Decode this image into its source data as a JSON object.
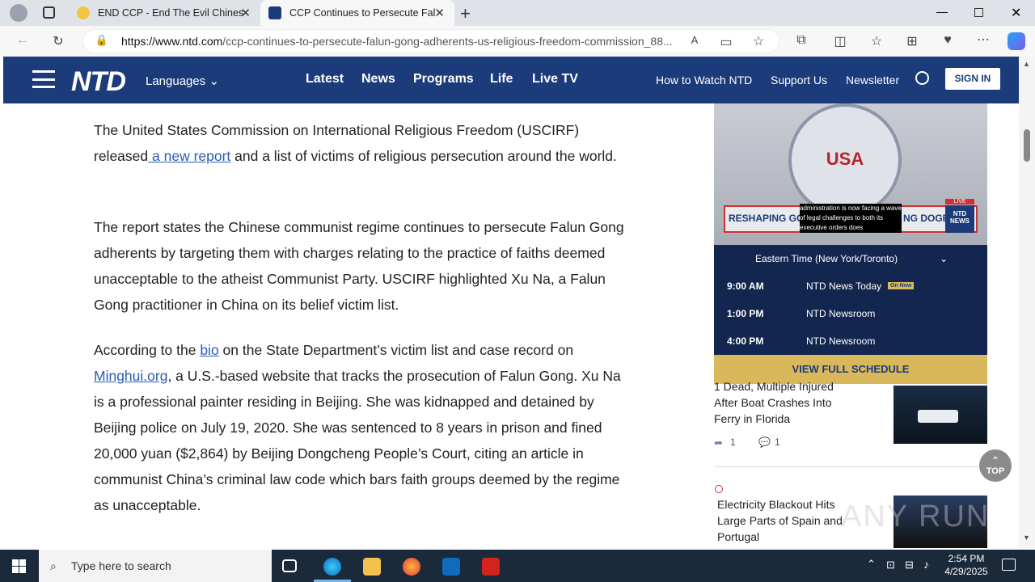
{
  "browser": {
    "tabs": [
      {
        "title": "END CCP - End The Evil Chinese",
        "favicon_color": "#f4c542"
      },
      {
        "title": "CCP Continues to Persecute Falu",
        "favicon_color": "#1c3b7a"
      }
    ],
    "url_host": "https://www.ntd.com",
    "url_path": "/ccp-continues-to-persecute-falun-gong-adherents-us-religious-freedom-commission_88..."
  },
  "site": {
    "logo": "NTD",
    "languages": "Languages",
    "nav": [
      "Latest",
      "News",
      "Programs",
      "Life",
      "Live TV"
    ],
    "secondary_nav": [
      "How to Watch NTD",
      "Support Us",
      "Newsletter"
    ],
    "signin": "SIGN IN"
  },
  "article": {
    "p1_start": "The United States Commission on International Religious Freedom (USCIRF) released",
    "p1_link": " a new report",
    "p1_end": " and a list of victims of religious persecution around the world.",
    "p2": "The report states the Chinese communist regime continues to persecute Falun Gong adherents by targeting them with charges relating to the practice of faiths deemed unacceptable to the atheist Communist Party. USCIRF highlighted Xu Na, a Falun Gong practitioner in China on its belief victim list.",
    "p3_a": "According to the ",
    "p3_link1": "bio",
    "p3_b": " on the State Department’s victim list and case record on ",
    "p3_link2": "Minghui.org",
    "p3_c": ", a U.S.-based website that tracks the prosecution of Falun Gong. Xu Na is a professional painter residing in Beijing. She was kidnapped and detained by Beijing police on July 19, 2020. She was sentenced to 8 years in prison and fined 20,000 yuan ($2,864) by Beijing Dongcheng People’s Court, citing an article in communist China’s criminal law code which bars faith groups deemed by the regime as unacceptable."
  },
  "video": {
    "seal_text": "USA",
    "ticker_left": "RESHAPING GOV",
    "ticker_caption": "administration is now facing a wave of legal challenges to both its executive orders does",
    "ticker_right": "NG DOGE",
    "live": "LIVE",
    "brand": "NTD NEWS"
  },
  "schedule": {
    "timezone": "Eastern Time (New York/Toronto)",
    "rows": [
      {
        "time": "9:00 AM",
        "show": "NTD News Today",
        "badge": "On Now"
      },
      {
        "time": "1:00 PM",
        "show": "NTD Newsroom",
        "badge": ""
      },
      {
        "time": "4:00 PM",
        "show": "NTD Newsroom",
        "badge": ""
      }
    ],
    "button": "VIEW FULL SCHEDULE"
  },
  "stories": [
    {
      "title": "1 Dead, Multiple Injured After Boat Crashes Into Ferry in Florida",
      "shares": "1",
      "comments": "1"
    },
    {
      "title": "Electricity Blackout Hits Large Parts of Spain and Portugal"
    }
  ],
  "top_button": "TOP",
  "watermark": "ANY RUN",
  "taskbar": {
    "search_placeholder": "Type here to search",
    "time": "2:54 PM",
    "date": "4/29/2025"
  }
}
